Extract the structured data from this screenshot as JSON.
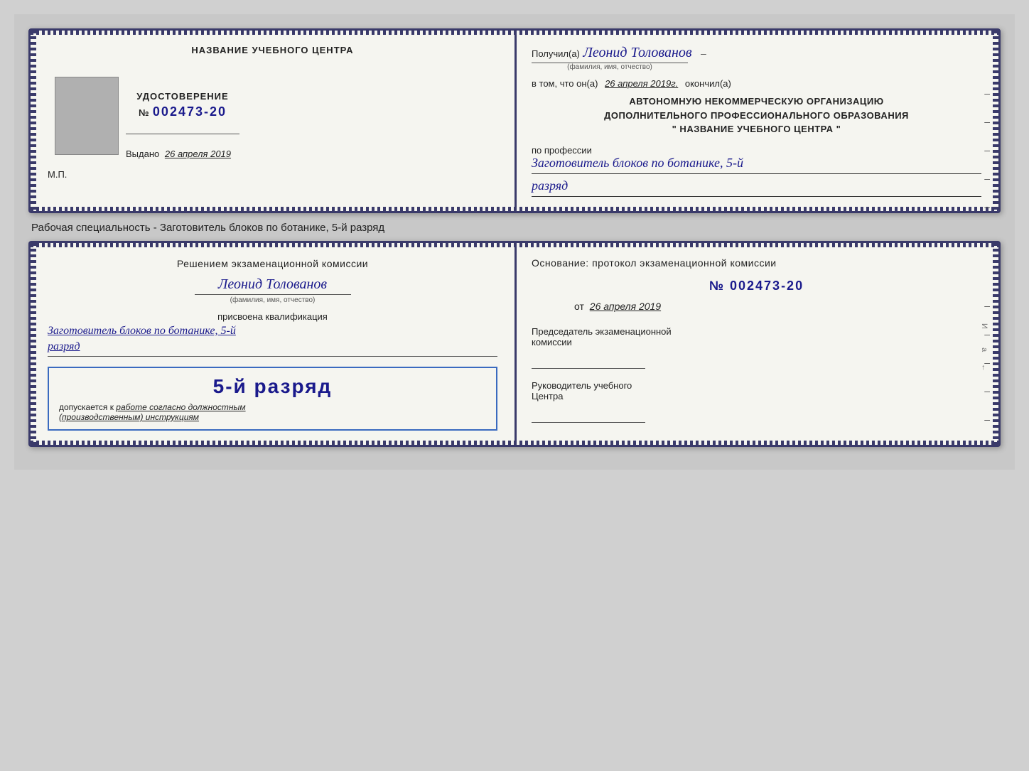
{
  "background_color": "#c8c8c8",
  "card1": {
    "left": {
      "title": "НАЗВАНИЕ УЧЕБНОГО ЦЕНТРА",
      "cert_label": "УДОСТОВЕРЕНИЕ",
      "cert_number_prefix": "№",
      "cert_number": "002473-20",
      "issued_label": "Выдано",
      "issued_date": "26 апреля 2019",
      "mp_label": "М.П."
    },
    "right": {
      "recipient_prefix": "Получил(а)",
      "recipient_name": "Леонид Толованов",
      "recipient_subtext": "(фамилия, имя, отчество)",
      "verified_line": "в том, что он(а)",
      "verified_date": "26 апреля 2019г.",
      "verified_suffix": "окончил(а)",
      "org_line1": "АВТОНОМНУЮ НЕКОММЕРЧЕСКУЮ ОРГАНИЗАЦИЮ",
      "org_line2": "ДОПОЛНИТЕЛЬНОГО ПРОФЕССИОНАЛЬНОГО ОБРАЗОВАНИЯ",
      "org_line3": "\"  НАЗВАНИЕ УЧЕБНОГО ЦЕНТРА  \"",
      "profession_label": "по профессии",
      "profession_name": "Заготовитель блоков по ботанике, 5-й",
      "rank": "разряд"
    }
  },
  "specialty_label": "Рабочая специальность - Заготовитель блоков по ботанике, 5-й разряд",
  "card2": {
    "left": {
      "decision_line1": "Решением экзаменационной комиссии",
      "decision_name": "Леонид Толованов",
      "decision_subtext": "(фамилия, имя, отчество)",
      "qualification_label": "присвоена квалификация",
      "qualification_name": "Заготовитель блоков по ботанике, 5-й",
      "rank": "разряд",
      "stamp_rank": "5-й разряд",
      "stamp_prefix": "допускается к",
      "stamp_italic": "работе согласно должностным",
      "stamp_italic2": "(производственным) инструкциям"
    },
    "right": {
      "basis_title": "Основание: протокол экзаменационной комиссии",
      "protocol_prefix": "№",
      "protocol_number": "002473-20",
      "date_prefix": "от",
      "date_value": "26 апреля 2019",
      "chairman_label": "Председатель экзаменационной",
      "chairman_label2": "комиссии",
      "head_label": "Руководитель учебного",
      "head_label2": "Центра"
    }
  }
}
